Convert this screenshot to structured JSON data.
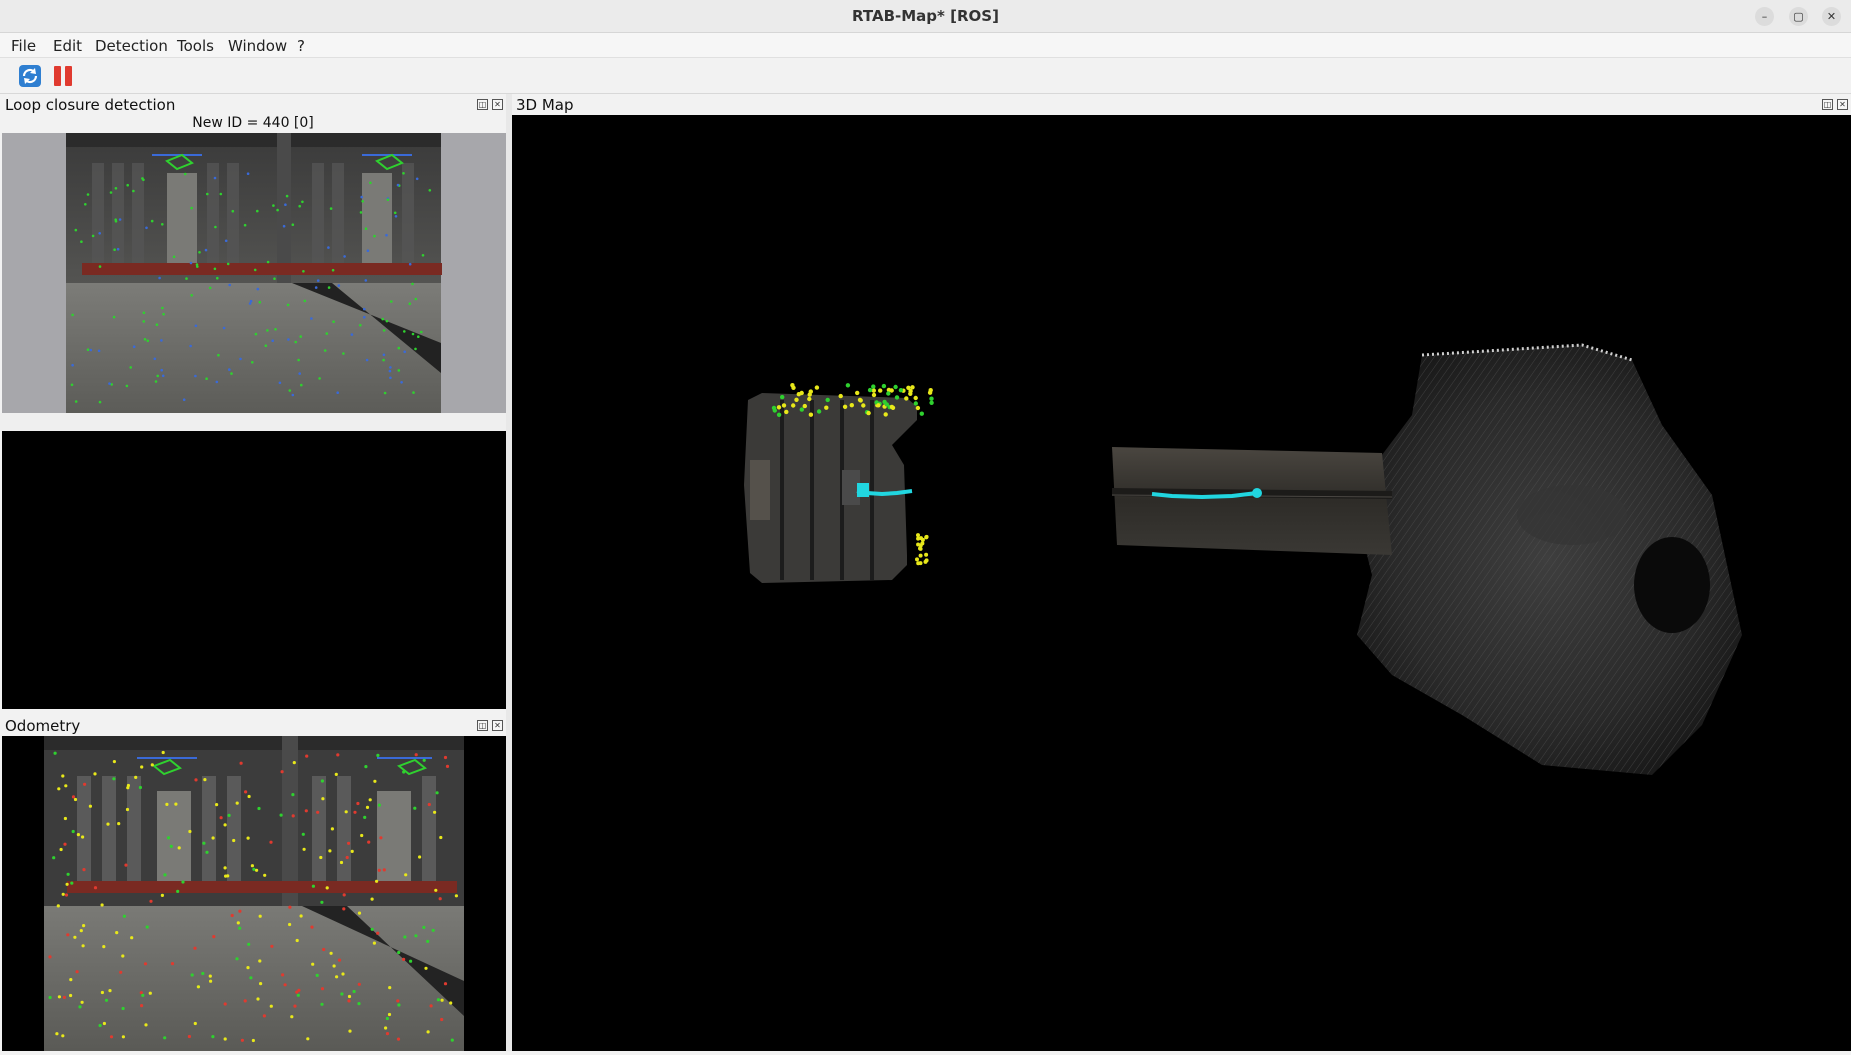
{
  "window": {
    "title": "RTAB-Map* [ROS]",
    "minimize_glyph": "–",
    "maximize_glyph": "▢",
    "close_glyph": "✕"
  },
  "menu": [
    "File",
    "Edit",
    "Detection",
    "Tools",
    "Window",
    "?"
  ],
  "toolbar": {
    "refresh_icon": "refresh-icon",
    "pause_icon": "pause-icon"
  },
  "loop_closure": {
    "title": "Loop closure detection",
    "new_id_label": "New ID = 440 [0]"
  },
  "map3d": {
    "title": "3D Map"
  },
  "odometry": {
    "title": "Odometry"
  },
  "colors": {
    "feature_green": "#2fd12f",
    "feature_yellow": "#e8e81a",
    "trajectory_cyan": "#21d6e0",
    "accent_red": "#e03a2f"
  }
}
